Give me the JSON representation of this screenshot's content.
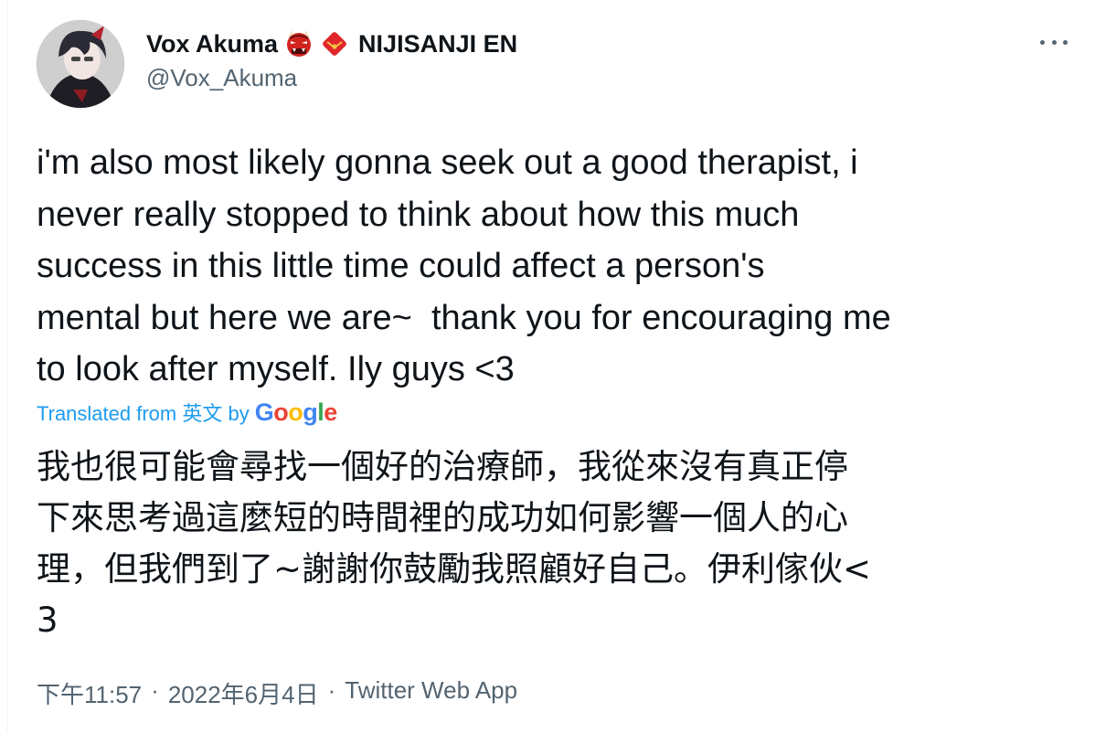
{
  "author": {
    "display_name": "Vox Akuma",
    "affiliation": "NIJISANJI EN",
    "handle": "@Vox_Akuma"
  },
  "tweet": {
    "text_lines": [
      "i'm also most likely gonna seek out a good therapist, i",
      "never really stopped to think about how this much",
      "success in this little time could affect a person's",
      "mental but here we are~  thank you for encouraging me",
      "to look after myself. Ily guys <3"
    ],
    "translation_label": "Translated from 英文 by",
    "translation_provider": "Google",
    "translated_lines": [
      "我也很可能會尋找一個好的治療師，我從來沒有真正停",
      "下來思考過這麼短的時間裡的成功如何影響一個人的心",
      "理，但我們到了~謝謝你鼓勵我照顧好自己。伊利傢伙<",
      "3"
    ]
  },
  "meta": {
    "time": "下午11:57",
    "date": "2022年6月4日",
    "source": "Twitter Web App",
    "separator": "·"
  },
  "icons": [
    "oni-emoji-icon",
    "red-envelope-emoji-icon",
    "more-options-icon"
  ],
  "colors": {
    "text": "#0f1419",
    "secondary": "#536471",
    "link": "#1d9bf0"
  }
}
